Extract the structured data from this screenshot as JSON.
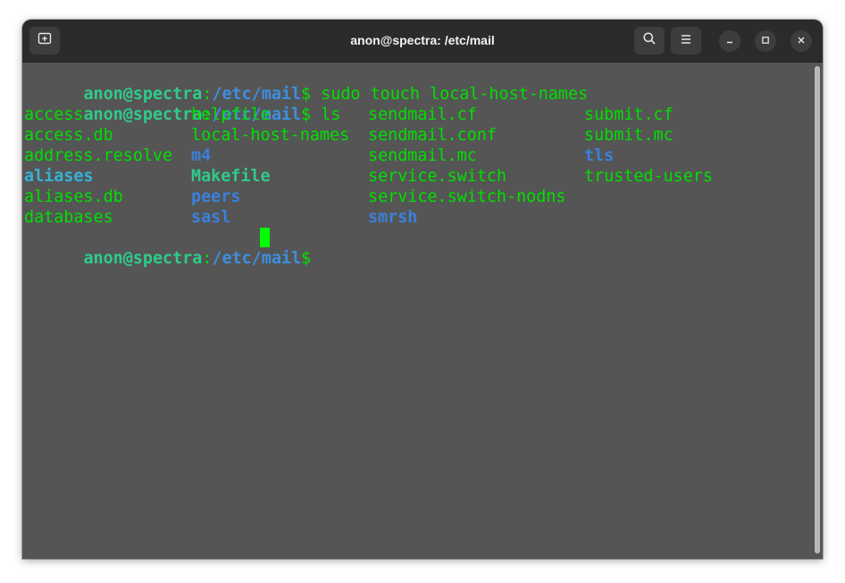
{
  "window": {
    "title": "anon@spectra: /etc/mail"
  },
  "titlebar": {
    "new_tab_icon": "new-tab-icon",
    "search_icon": "search-icon",
    "menu_icon": "hamburger-menu-icon",
    "minimize_icon": "minimize-icon",
    "maximize_icon": "maximize-icon",
    "close_icon": "close-icon"
  },
  "prompt": {
    "user_host": "anon@spectra",
    "colon": ":",
    "path": "/etc/mail",
    "dollar": "$ "
  },
  "commands": [
    "sudo touch local-host-names",
    "ls"
  ],
  "ls_columns": [
    [
      {
        "name": "access",
        "style": "regular"
      },
      {
        "name": "access.db",
        "style": "regular"
      },
      {
        "name": "address.resolve",
        "style": "regular"
      },
      {
        "name": "aliases",
        "style": "symlink"
      },
      {
        "name": "aliases.db",
        "style": "regular"
      },
      {
        "name": "databases",
        "style": "regular"
      }
    ],
    [
      {
        "name": "helpfile",
        "style": "regular"
      },
      {
        "name": "local-host-names",
        "style": "regular"
      },
      {
        "name": "m4",
        "style": "directory"
      },
      {
        "name": "Makefile",
        "style": "executable"
      },
      {
        "name": "peers",
        "style": "directory"
      },
      {
        "name": "sasl",
        "style": "directory"
      }
    ],
    [
      {
        "name": "sendmail.cf",
        "style": "regular"
      },
      {
        "name": "sendmail.conf",
        "style": "regular"
      },
      {
        "name": "sendmail.mc",
        "style": "regular"
      },
      {
        "name": "service.switch",
        "style": "regular"
      },
      {
        "name": "service.switch-nodns",
        "style": "regular"
      },
      {
        "name": "smrsh",
        "style": "directory"
      }
    ],
    [
      {
        "name": "submit.cf",
        "style": "regular"
      },
      {
        "name": "submit.mc",
        "style": "regular"
      },
      {
        "name": "tls",
        "style": "directory"
      },
      {
        "name": "trusted-users",
        "style": "regular"
      }
    ]
  ],
  "colors": {
    "terminal_bg": "#555555",
    "titlebar_bg": "#2b2b2b",
    "prompt_user": "#2fcb8a",
    "prompt_path": "#3c8fe0",
    "text": "#00e000",
    "directory": "#3a80dc",
    "symlink": "#36b2d8",
    "executable": "#2fcb8a",
    "cursor": "#00ff00"
  }
}
